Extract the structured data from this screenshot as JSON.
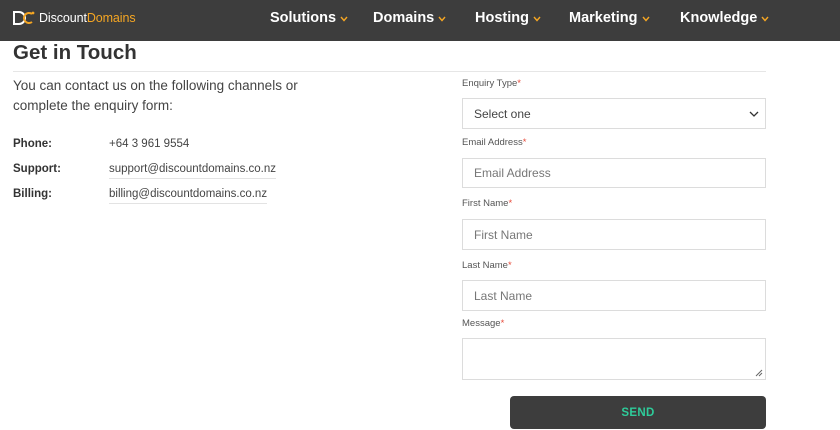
{
  "brand": {
    "name_part1": "Discount",
    "name_part2": "Domains",
    "accent_color": "#f5a623"
  },
  "nav": {
    "items": [
      {
        "label": "Solutions",
        "icon": "chevron-down-icon"
      },
      {
        "label": "Domains",
        "icon": "chevron-down-icon"
      },
      {
        "label": "Hosting",
        "icon": "chevron-down-icon"
      },
      {
        "label": "Marketing",
        "icon": "chevron-down-icon"
      },
      {
        "label": "Knowledge",
        "icon": "chevron-down-icon"
      }
    ]
  },
  "page": {
    "title": "Get in Touch",
    "intro": "You can contact us on the following channels or complete the enquiry form:"
  },
  "contacts": [
    {
      "label": "Phone:",
      "value": "+64 3 961 9554"
    },
    {
      "label": "Support:",
      "value": "support@discountdomains.co.nz"
    },
    {
      "label": "Billing:",
      "value": "billing@discountdomains.co.nz"
    }
  ],
  "form": {
    "enquiry_type": {
      "label": "Enquiry Type",
      "required_mark": "*",
      "selected": "Select one"
    },
    "email": {
      "label": "Email Address",
      "required_mark": "*",
      "placeholder": "Email Address"
    },
    "first_name": {
      "label": "First Name",
      "required_mark": "*",
      "placeholder": "First Name"
    },
    "last_name": {
      "label": "Last Name",
      "required_mark": "*",
      "placeholder": "Last Name"
    },
    "message": {
      "label": "Message",
      "required_mark": "*",
      "placeholder": ""
    },
    "send_label": "SEND",
    "send_text_color": "#2ecc9a"
  },
  "colors": {
    "header_bg": "#3d3d3d",
    "required": "#e74c3c"
  }
}
